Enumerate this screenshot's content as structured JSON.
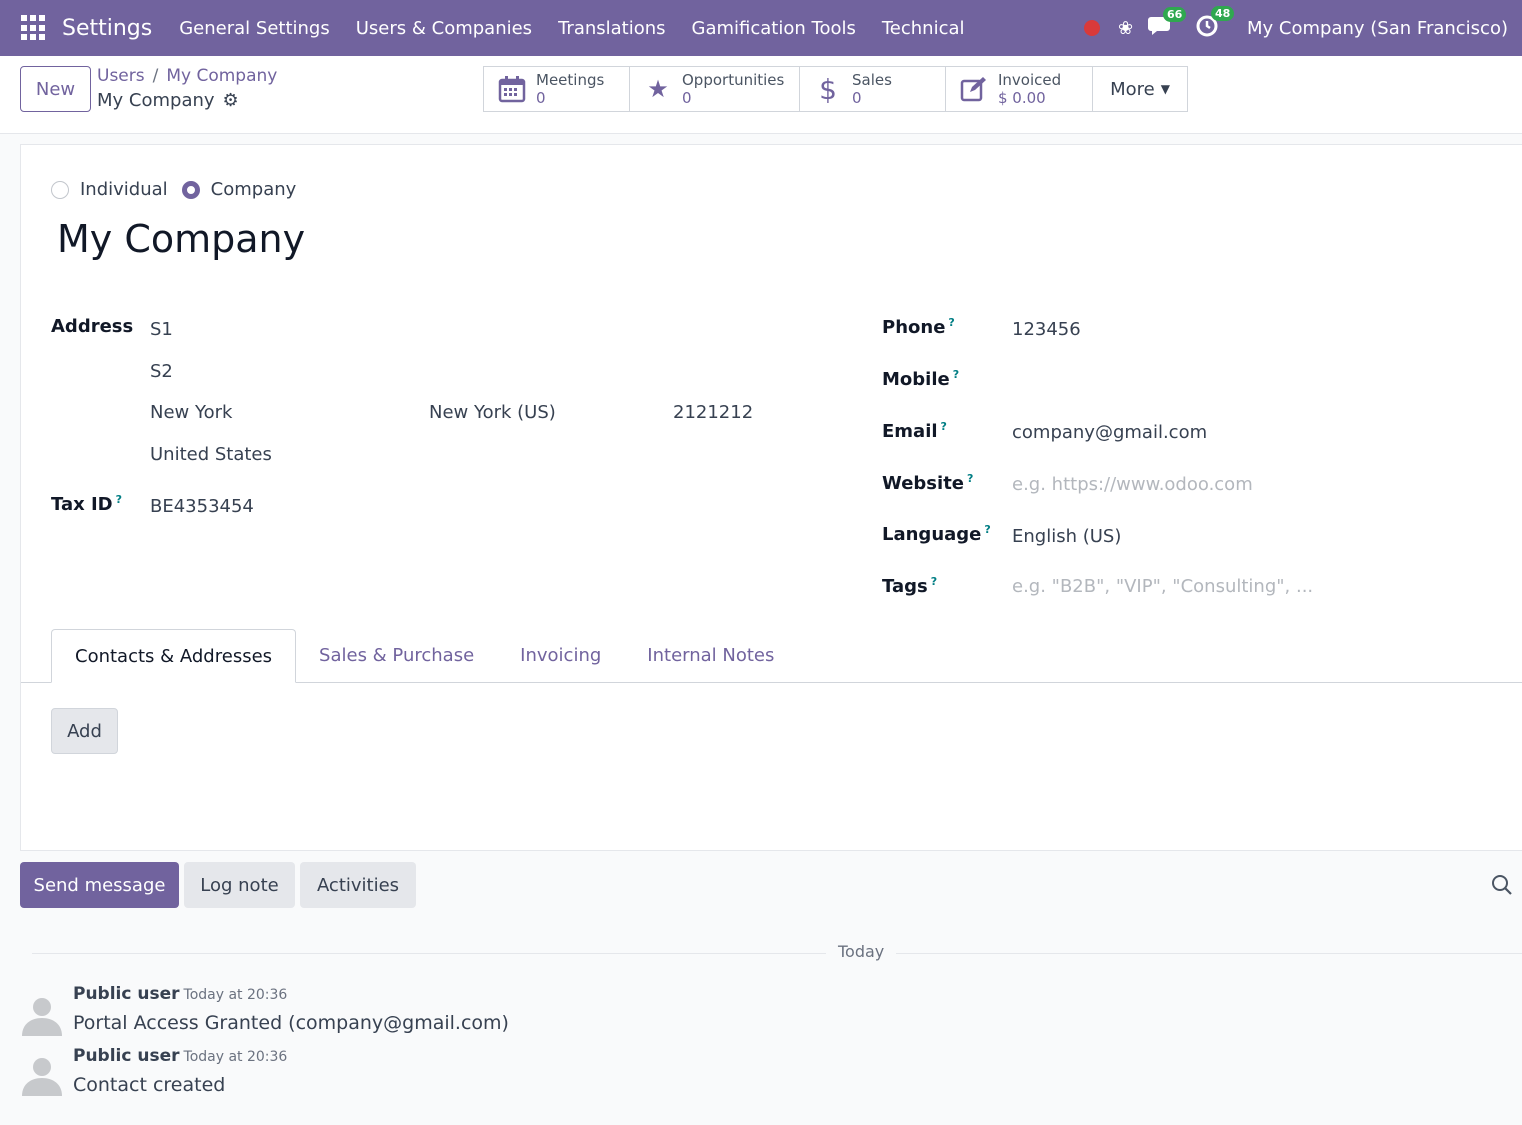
{
  "navbar": {
    "brand": "Settings",
    "menu": [
      "General Settings",
      "Users & Companies",
      "Translations",
      "Gamification Tools",
      "Technical"
    ],
    "messages_count": "66",
    "activities_count": "48",
    "company": "My Company (San Francisco)",
    "accent": "#71639e"
  },
  "control": {
    "new_label": "New",
    "breadcrumb": [
      "Users",
      "My Company"
    ],
    "record_name": "My Company",
    "stats": [
      {
        "label": "Meetings",
        "value": "0",
        "icon": "calendar-icon"
      },
      {
        "label": "Opportunities",
        "value": "0",
        "icon": "star-icon"
      },
      {
        "label": "Sales",
        "value": "0",
        "icon": "dollar-icon"
      },
      {
        "label": "Invoiced",
        "value": "$ 0.00",
        "icon": "edit-icon"
      }
    ],
    "more_label": "More"
  },
  "form": {
    "type_individual": "Individual",
    "type_company": "Company",
    "name": "My Company",
    "address_label": "Address",
    "street": "S1",
    "street2": "S2",
    "city": "New York",
    "state": "New York (US)",
    "zip": "2121212",
    "country": "United States",
    "tax_label": "Tax ID",
    "tax_value": "BE4353454",
    "phone_label": "Phone",
    "phone_value": "123456",
    "mobile_label": "Mobile",
    "email_label": "Email",
    "email_value": "company@gmail.com",
    "website_label": "Website",
    "website_placeholder": "e.g. https://www.odoo.com",
    "language_label": "Language",
    "language_value": "English (US)",
    "tags_label": "Tags",
    "tags_placeholder": "e.g. \"B2B\", \"VIP\", \"Consulting\", ...",
    "help_mark": "?",
    "tabs": [
      "Contacts & Addresses",
      "Sales & Purchase",
      "Invoicing",
      "Internal Notes"
    ],
    "add_label": "Add"
  },
  "chatter": {
    "send_label": "Send message",
    "log_label": "Log note",
    "activities_label": "Activities",
    "today_label": "Today",
    "messages": [
      {
        "author": "Public user",
        "date": "Today at 20:36",
        "body": "Portal Access Granted (company@gmail.com)"
      },
      {
        "author": "Public user",
        "date": "Today at 20:36",
        "body": "Contact created"
      }
    ]
  }
}
